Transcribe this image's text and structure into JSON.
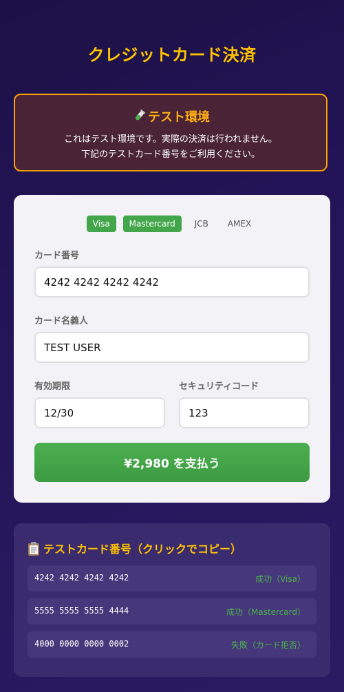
{
  "page": {
    "title": "クレジットカード決済"
  },
  "banner": {
    "title": "テスト環境",
    "line1": "これはテスト環境です。実際の決済は行われません。",
    "line2": "下記のテストカード番号をご利用ください。",
    "icon": "test-tube-icon"
  },
  "brands": [
    "Visa",
    "Mastercard",
    "JCB",
    "AMEX"
  ],
  "brands_active": [
    "Visa",
    "Mastercard"
  ],
  "form": {
    "card_number_label": "カード番号",
    "card_number_value": "4242 4242 4242 4242",
    "card_name_label": "カード名義人",
    "card_name_value": "TEST USER",
    "expiry_label": "有効期限",
    "expiry_value": "12/30",
    "cvc_label": "セキュリティコード",
    "cvc_value": "123",
    "pay_button": "¥2,980 を支払う"
  },
  "test_cards": {
    "title": "テストカード番号（クリックでコピー）",
    "icon": "clipboard-icon",
    "items": [
      {
        "number": "4242 4242 4242 4242",
        "result": "成功（Visa）"
      },
      {
        "number": "5555 5555 5555 4444",
        "result": "成功（Mastercard）"
      },
      {
        "number": "4000 0000 0000 0002",
        "result": "失敗（カード拒否）"
      }
    ]
  },
  "colors": {
    "accent_yellow": "#ffc300",
    "banner_border": "#ffa000",
    "success_green": "#4caf50",
    "background": "#1c1146"
  }
}
